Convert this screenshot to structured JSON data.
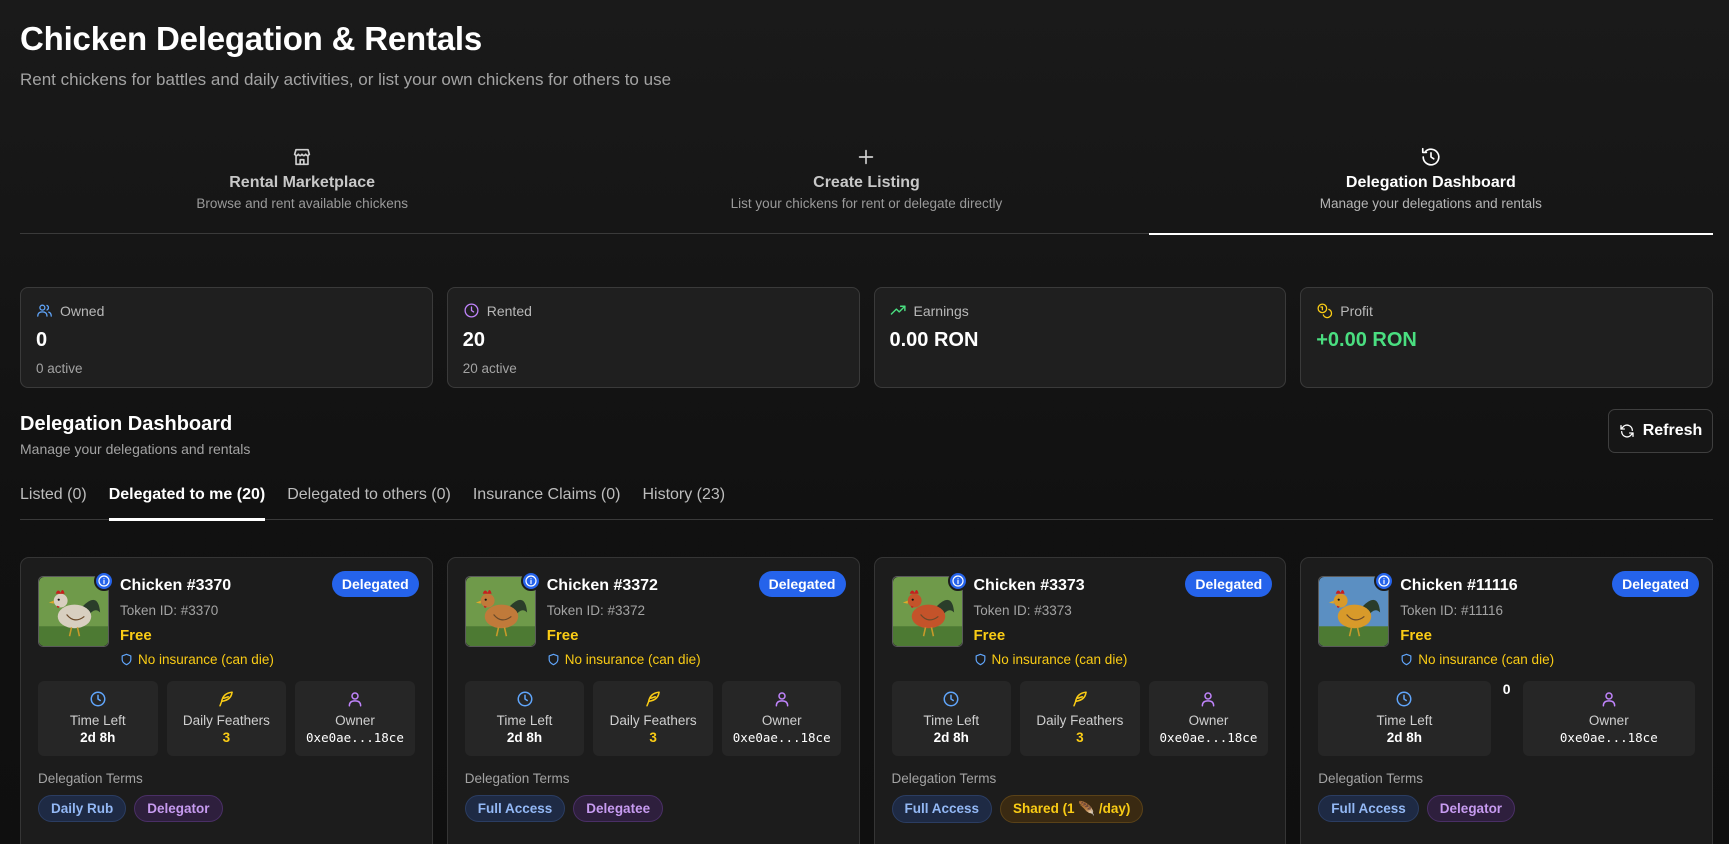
{
  "header": {
    "title": "Chicken Delegation & Rentals",
    "subtitle": "Rent chickens for battles and daily activities, or list your own chickens for others to use"
  },
  "main_tabs": [
    {
      "label": "Rental Marketplace",
      "desc": "Browse and rent available chickens",
      "icon": "store-icon",
      "active": false
    },
    {
      "label": "Create Listing",
      "desc": "List your chickens for rent or delegate directly",
      "icon": "plus-icon",
      "active": false
    },
    {
      "label": "Delegation Dashboard",
      "desc": "Manage your delegations and rentals",
      "icon": "history-icon",
      "active": true
    }
  ],
  "stats": [
    {
      "label": "Owned",
      "value": "0",
      "sub": "0 active",
      "icon": "users-icon",
      "color": "#60a5fa"
    },
    {
      "label": "Rented",
      "value": "20",
      "sub": "20 active",
      "icon": "clock-icon",
      "color": "#c084fc"
    },
    {
      "label": "Earnings",
      "value": "0.00 RON",
      "sub": "",
      "icon": "trending-up-icon",
      "color": "#4ade80"
    },
    {
      "label": "Profit",
      "value": "+0.00 RON",
      "sub": "",
      "icon": "coins-icon",
      "color": "#facc15"
    }
  ],
  "section": {
    "title": "Delegation Dashboard",
    "subtitle": "Manage your delegations and rentals",
    "refresh_label": "Refresh"
  },
  "sub_tabs": [
    {
      "label": "Listed (0)",
      "active": false
    },
    {
      "label": "Delegated to me (20)",
      "active": true
    },
    {
      "label": "Delegated to others (0)",
      "active": false
    },
    {
      "label": "Insurance Claims (0)",
      "active": false
    },
    {
      "label": "History (23)",
      "active": false
    }
  ],
  "cards": [
    {
      "name": "Chicken #3370",
      "token": "Token ID: #3370",
      "price": "Free",
      "insurance": "No insurance (can die)",
      "status": "Delegated",
      "time_left_label": "Time Left",
      "time_left": "2d 8h",
      "feathers_label": "Daily Feathers",
      "feathers": "3",
      "owner_label": "Owner",
      "owner": "0xe0ae...18ce",
      "terms_label": "Delegation Terms",
      "terms": [
        {
          "text": "Daily Rub",
          "style": "blue"
        },
        {
          "text": "Delegator",
          "style": "purple"
        }
      ],
      "avatar_bg": "#6f9a4a",
      "chicken_color": "#d8cfc0",
      "comb_color": "#c81e1e"
    },
    {
      "name": "Chicken #3372",
      "token": "Token ID: #3372",
      "price": "Free",
      "insurance": "No insurance (can die)",
      "status": "Delegated",
      "time_left_label": "Time Left",
      "time_left": "2d 8h",
      "feathers_label": "Daily Feathers",
      "feathers": "3",
      "owner_label": "Owner",
      "owner": "0xe0ae...18ce",
      "terms_label": "Delegation Terms",
      "terms": [
        {
          "text": "Full Access",
          "style": "blue"
        },
        {
          "text": "Delegatee",
          "style": "purple"
        }
      ],
      "avatar_bg": "#6f9a4a",
      "chicken_color": "#c07a3a",
      "comb_color": "#c81e1e"
    },
    {
      "name": "Chicken #3373",
      "token": "Token ID: #3373",
      "price": "Free",
      "insurance": "No insurance (can die)",
      "status": "Delegated",
      "time_left_label": "Time Left",
      "time_left": "2d 8h",
      "feathers_label": "Daily Feathers",
      "feathers": "3",
      "owner_label": "Owner",
      "owner": "0xe0ae...18ce",
      "terms_label": "Delegation Terms",
      "terms": [
        {
          "text": "Full Access",
          "style": "blue"
        },
        {
          "text": "Shared (1 🪶 /day)",
          "style": "gold"
        }
      ],
      "avatar_bg": "#6f9a4a",
      "chicken_color": "#c4532a",
      "comb_color": "#c81e1e"
    },
    {
      "name": "Chicken #11116",
      "token": "Token ID: #11116",
      "price": "Free",
      "insurance": "No insurance (can die)",
      "status": "Delegated",
      "time_left_label": "Time Left",
      "time_left": "2d 8h",
      "feathers_label": "",
      "feathers": "0",
      "feathers_stray": true,
      "owner_label": "Owner",
      "owner": "0xe0ae...18ce",
      "terms_label": "Delegation Terms",
      "terms": [
        {
          "text": "Full Access",
          "style": "blue"
        },
        {
          "text": "Delegator",
          "style": "purple"
        }
      ],
      "avatar_bg": "#5b8fc2",
      "chicken_color": "#d89a2a",
      "comb_color": "#c81e1e"
    }
  ]
}
